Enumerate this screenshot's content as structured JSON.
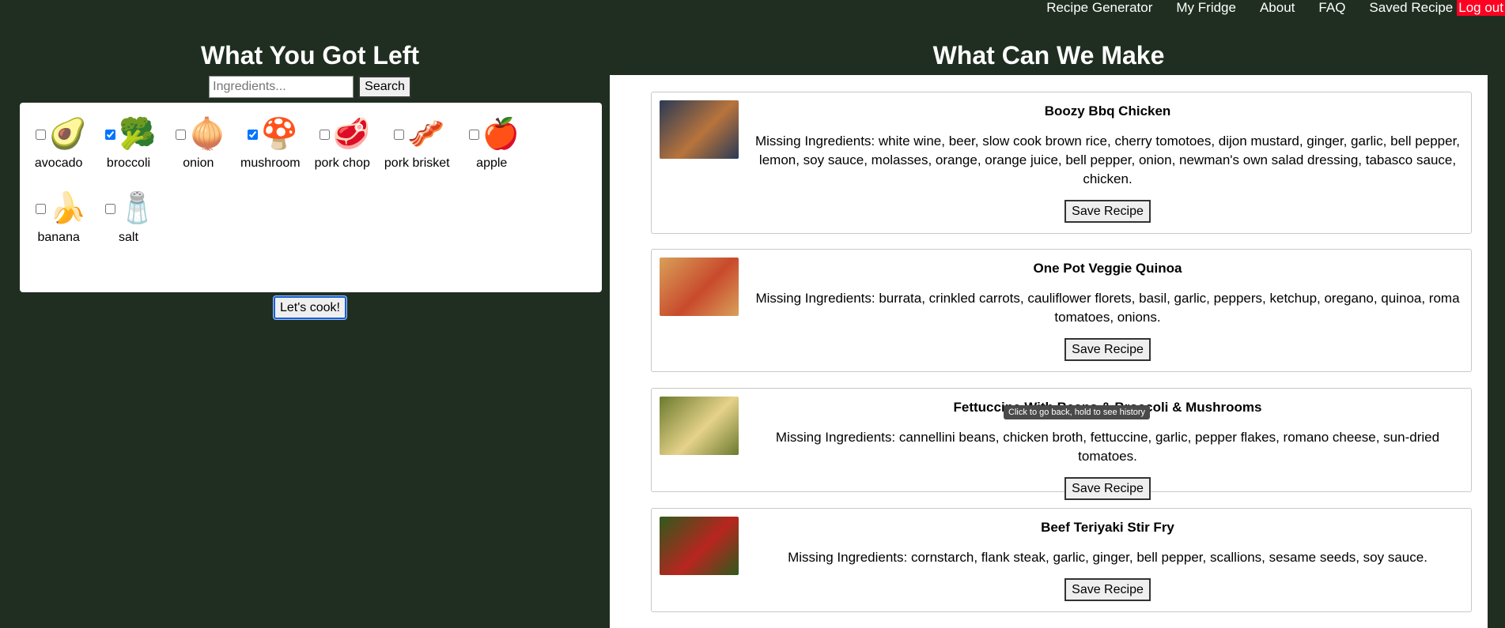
{
  "nav": {
    "items": [
      "Recipe Generator",
      "My Fridge",
      "About",
      "FAQ",
      "Saved Recipe"
    ],
    "logout": "Log out"
  },
  "left": {
    "title": "What You Got Left",
    "search": {
      "placeholder": "Ingredients...",
      "button": "Search"
    },
    "ingredients": [
      {
        "name": "avocado",
        "icon": "🥑",
        "checked": false
      },
      {
        "name": "broccoli",
        "icon": "🥦",
        "checked": true
      },
      {
        "name": "onion",
        "icon": "🧅",
        "checked": false
      },
      {
        "name": "mushroom",
        "icon": "🍄",
        "checked": true
      },
      {
        "name": "pork chop",
        "icon": "🥩",
        "checked": false
      },
      {
        "name": "pork brisket",
        "icon": "🥓",
        "checked": false
      },
      {
        "name": "apple",
        "icon": "🍎",
        "checked": false
      },
      {
        "name": "banana",
        "icon": "🍌",
        "checked": false
      },
      {
        "name": "salt",
        "icon": "🧂",
        "checked": false
      }
    ],
    "cook_button": "Let's cook!"
  },
  "right": {
    "title": "What Can We Make",
    "save_label": "Save Recipe",
    "recipes": [
      {
        "title": "Boozy Bbq Chicken",
        "missing": "Missing Ingredients: white wine, beer, slow cook brown rice, cherry tomotoes, dijon mustard, ginger, garlic, bell pepper, lemon, soy sauce, molasses, orange, orange juice, bell pepper, onion, newman's own salad dressing, tabasco sauce, chicken.",
        "img_colors": [
          "#2b3a55",
          "#b8743c"
        ]
      },
      {
        "title": "One Pot Veggie Quinoa",
        "missing": "Missing Ingredients: burrata, crinkled carrots, cauliflower florets, basil, garlic, peppers, ketchup, oregano, quinoa, roma tomatoes, onions.",
        "img_colors": [
          "#d9a05a",
          "#c84a2c"
        ]
      },
      {
        "title": "Fettuccine With Beans & Broccoli & Mushrooms",
        "missing": "Missing Ingredients: cannellini beans, chicken broth, fettuccine, garlic, pepper flakes, romano cheese, sun-dried tomatoes.",
        "img_colors": [
          "#6b7a2e",
          "#e6d28a"
        ]
      },
      {
        "title": "Beef Teriyaki Stir Fry",
        "missing": "Missing Ingredients: cornstarch, flank steak, garlic, ginger, bell pepper, scallions, sesame seeds, soy sauce.",
        "img_colors": [
          "#2f5a1c",
          "#b8251f"
        ]
      }
    ]
  },
  "tooltip": "Click to go back, hold to see history"
}
